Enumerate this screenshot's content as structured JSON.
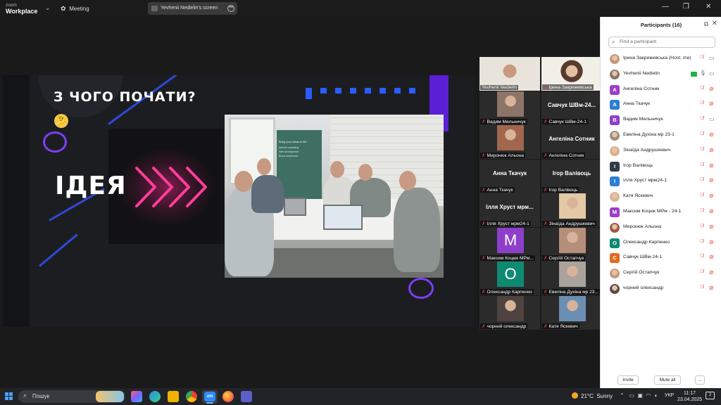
{
  "titlebar": {
    "brand_line1": "zoom",
    "brand_line2": "Workplace",
    "meeting_label": "Meeting",
    "screen_share_label": "Yevhenii Nedielin's screen"
  },
  "slide": {
    "heading": "З ЧОГО ПОЧАТИ?",
    "idea_word": "ІДЕЯ",
    "banner_title": "Bring your ideas to life",
    "banner_items": [
      "Internet marketing",
      "Web development",
      "Brand awareness"
    ]
  },
  "video_tiles": [
    {
      "name": "Yevhenii Nedielin",
      "muted": false,
      "kind": "photo",
      "active": true
    },
    {
      "name": "Ірина Закрижевська",
      "muted": true,
      "kind": "photo"
    },
    {
      "name": "Вадим Мельничук",
      "muted": true,
      "kind": "photo"
    },
    {
      "name": "Савчук ШВм-24-1",
      "muted": true,
      "kind": "text",
      "big": "Савчук ШВм-24..."
    },
    {
      "name": "Миронюк Альона",
      "muted": true,
      "kind": "photo"
    },
    {
      "name": "Ангеліна Сотник",
      "muted": true,
      "kind": "text",
      "big": "Ангеліна Сотник"
    },
    {
      "name": "Анна Ткачук",
      "muted": true,
      "kind": "text",
      "big": "Анна Ткачук"
    },
    {
      "name": "Ігор Валівоць",
      "muted": true,
      "kind": "text",
      "big": "Ігор Валівоць"
    },
    {
      "name": "Ілля Хруст мрм24-1",
      "muted": true,
      "kind": "text",
      "big": "Ілля Хруст мрм..."
    },
    {
      "name": "Зінаїда Андрушкевич",
      "muted": true,
      "kind": "photo"
    },
    {
      "name": "Максим Коцюк МРм...",
      "muted": true,
      "kind": "letter",
      "letter": "M",
      "color": "#8e3fc9"
    },
    {
      "name": "Сергій Остапчук",
      "muted": true,
      "kind": "photo"
    },
    {
      "name": "Олександр Карпенко",
      "muted": true,
      "kind": "letter",
      "letter": "O",
      "color": "#0f8a72"
    },
    {
      "name": "Евеліна Духіна мр 23...",
      "muted": true,
      "kind": "photo"
    },
    {
      "name": "чорний олександр",
      "muted": true,
      "kind": "photo"
    },
    {
      "name": "Катя Яскевич",
      "muted": true,
      "kind": "photo"
    }
  ],
  "participants_panel": {
    "title": "Participants (16)",
    "search_placeholder": "Find a participant",
    "invite_label": "Invite",
    "mute_all_label": "Mute all",
    "more_label": "...",
    "participants": [
      {
        "name": "Ірина Закрижевська (Host, me)",
        "avatar": "photo",
        "color": "#c49a7c",
        "muted": true,
        "video_off": false
      },
      {
        "name": "Yevhenii Nedielin",
        "avatar": "photo",
        "color": "#8a7766",
        "muted": false,
        "video_off": false,
        "sharing": true
      },
      {
        "name": "Ангеліна Сотник",
        "avatar": "A",
        "color": "#9b40c6",
        "muted": true,
        "video_off": true
      },
      {
        "name": "Анна Ткачук",
        "avatar": "A",
        "color": "#2d7fd1",
        "muted": true,
        "video_off": true
      },
      {
        "name": "Вадим Мельничук",
        "avatar": "B",
        "color": "#8e3fc9",
        "muted": true,
        "video_off": false
      },
      {
        "name": "Евеліна Духіна мр 23-1",
        "avatar": "photo",
        "color": "#9c8f80",
        "muted": true,
        "video_off": true
      },
      {
        "name": "Зінаїда Андрушкевич",
        "avatar": "photo",
        "color": "#d9b08a",
        "muted": true,
        "video_off": true
      },
      {
        "name": "Ігор Валівоць",
        "avatar": "I",
        "color": "#2f3a4a",
        "muted": true,
        "video_off": true
      },
      {
        "name": "Ілля Хруст мрм24-1",
        "avatar": "I",
        "color": "#2d7fd1",
        "muted": true,
        "video_off": true
      },
      {
        "name": "Катя Яскевич",
        "avatar": "photo",
        "color": "#d4b89b",
        "muted": true,
        "video_off": true
      },
      {
        "name": "Максим Коцюк МРм - 24-1",
        "avatar": "M",
        "color": "#9b40c6",
        "muted": true,
        "video_off": true
      },
      {
        "name": "Миронюк Альона",
        "avatar": "photo",
        "color": "#9a5d44",
        "muted": true,
        "video_off": true
      },
      {
        "name": "Олександр Карпенко",
        "avatar": "O",
        "color": "#0f8a72",
        "muted": true,
        "video_off": true
      },
      {
        "name": "Савчук ШВм-24-1",
        "avatar": "C",
        "color": "#e06a1f",
        "muted": true,
        "video_off": true
      },
      {
        "name": "Сергій Остапчук",
        "avatar": "photo",
        "color": "#c79a83",
        "muted": true,
        "video_off": true
      },
      {
        "name": "чорний олександр",
        "avatar": "photo",
        "color": "#5a4c48",
        "muted": true,
        "video_off": true
      }
    ]
  },
  "taskbar": {
    "search_label": "Пошук",
    "weather_temp": "21°C",
    "weather_text": "Sunny",
    "language": "УКР",
    "time": "11:17",
    "date": "23.04.2025",
    "zoom_app_label": "zm",
    "notification_count": "2"
  }
}
